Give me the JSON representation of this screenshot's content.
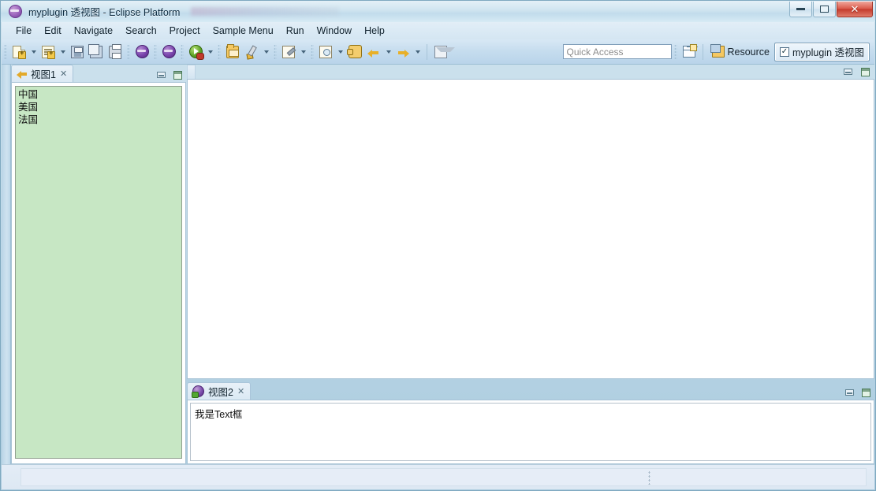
{
  "window": {
    "title": "myplugin 透视图 - Eclipse Platform",
    "logo_icon": "eclipse-logo",
    "controls": {
      "minimize": "−",
      "maximize": "▢",
      "close": "✕"
    }
  },
  "menubar": {
    "items": [
      {
        "label": "File"
      },
      {
        "label": "Edit"
      },
      {
        "label": "Navigate"
      },
      {
        "label": "Search"
      },
      {
        "label": "Project"
      },
      {
        "label": "Sample Menu"
      },
      {
        "label": "Run"
      },
      {
        "label": "Window"
      },
      {
        "label": "Help"
      }
    ]
  },
  "toolbar": {
    "groups": [
      {
        "buttons": [
          {
            "icon": "new-wizard-icon",
            "dropdown": true
          },
          {
            "icon": "new-java-file-icon",
            "dropdown": true
          },
          {
            "icon": "save-icon",
            "dropdown": false
          },
          {
            "icon": "save-all-icon",
            "dropdown": false
          },
          {
            "icon": "print-icon",
            "dropdown": false
          }
        ]
      },
      {
        "buttons": [
          {
            "icon": "ellipse-purple-icon",
            "dropdown": false
          }
        ]
      },
      {
        "buttons": [
          {
            "icon": "ellipse-purple-icon",
            "dropdown": false
          }
        ]
      },
      {
        "buttons": [
          {
            "icon": "debug-icon",
            "dropdown": true
          }
        ]
      },
      {
        "buttons": [
          {
            "icon": "open-folder-icon",
            "dropdown": false
          },
          {
            "icon": "external-tools-icon",
            "dropdown": true
          }
        ]
      },
      {
        "buttons": [
          {
            "icon": "next-annotation-icon",
            "dropdown": true
          }
        ]
      },
      {
        "buttons": [
          {
            "icon": "search-icon",
            "dropdown": true
          },
          {
            "icon": "last-edit-location-icon",
            "dropdown": false
          },
          {
            "icon": "back-arrow-icon",
            "dropdown": true
          },
          {
            "icon": "forward-arrow-icon",
            "dropdown": true
          }
        ]
      },
      {
        "buttons": [
          {
            "icon": "mail-icon",
            "dropdown": false
          }
        ]
      }
    ],
    "quick_access": {
      "placeholder": "Quick Access",
      "value": ""
    },
    "open_perspective": {
      "icon": "open-perspective-icon",
      "label": ""
    },
    "perspectives": [
      {
        "label": "Resource",
        "icon": "resource-perspective-icon",
        "active": false,
        "checked": false
      },
      {
        "label": "myplugin 透视图",
        "icon": "",
        "active": true,
        "checked": true,
        "check_glyph": "✓"
      }
    ]
  },
  "views": {
    "view1": {
      "tab_label": "视图1",
      "tab_icon": "yellow-left-arrow-icon",
      "close_glyph": "✕",
      "controls": {
        "minimize": "minimize-icon",
        "maximize": "maximize-icon"
      },
      "list_items": [
        "中国",
        "美国",
        "法国"
      ],
      "list_background": "#c7e7c4"
    },
    "view2": {
      "tab_label": "视图2",
      "tab_icon": "sample-purple-icon",
      "close_glyph": "✕",
      "controls": {
        "minimize": "minimize-icon",
        "maximize": "maximize-icon"
      },
      "text_value": "我是Text框"
    },
    "editor": {
      "controls": {
        "minimize": "minimize-icon",
        "maximize": "maximize-icon"
      },
      "content": ""
    }
  },
  "statusbar": {
    "text": "",
    "grip_icon": "resize-grip-icon"
  }
}
